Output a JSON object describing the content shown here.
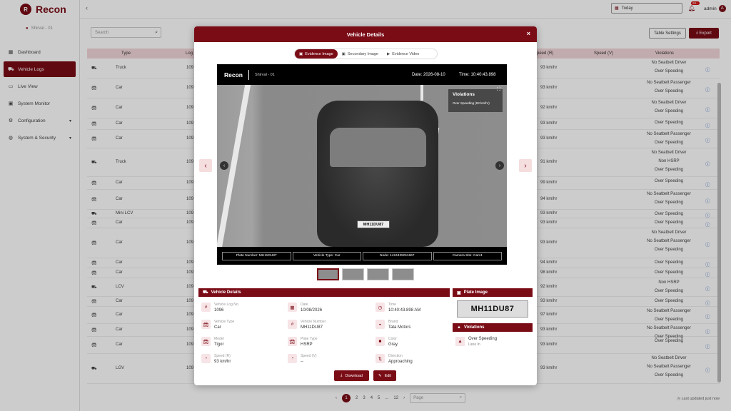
{
  "app": {
    "name": "Recon",
    "logo_letter": "R",
    "location": "Shirval - 01"
  },
  "sidebar": {
    "items": [
      {
        "label": "Dashboard",
        "icon": "grid-icon"
      },
      {
        "label": "Vehicle Logs",
        "icon": "car-icon",
        "active": true
      },
      {
        "label": "Live View",
        "icon": "camera-icon"
      },
      {
        "label": "System Monitor",
        "icon": "monitor-icon"
      },
      {
        "label": "Configuration",
        "icon": "gear-icon"
      },
      {
        "label": "System & Security",
        "icon": "globe-icon"
      }
    ]
  },
  "topbar": {
    "date_label": "Today",
    "notif_badge": "99+",
    "user": "admin",
    "user_initial": "A"
  },
  "toolbar": {
    "search_placeholder": "Search",
    "table_settings": "Table Settings",
    "export": "Export"
  },
  "table": {
    "headers": {
      "type": "Type",
      "log": "Log",
      "speed_r": "Speed (R)",
      "speed_v": "Speed (V)",
      "violations": "Violations"
    },
    "rows": [
      {
        "type": "Truck",
        "log": "109",
        "speed": "93 km/hr",
        "viol": [
          "No Seatbelt Driver",
          "Over Speeding"
        ]
      },
      {
        "type": "Car",
        "log": "109",
        "speed": "93 km/hr",
        "viol": [
          "No Seatbelt Passenger",
          "Over Speeding"
        ]
      },
      {
        "type": "Car",
        "log": "109",
        "speed": "92 km/hr",
        "viol": [
          "No Seatbelt Driver",
          "Over Speeding"
        ]
      },
      {
        "type": "Car",
        "log": "109",
        "speed": "93 km/hr",
        "viol": [
          "Over Speeding"
        ]
      },
      {
        "type": "Car",
        "log": "109",
        "speed": "93 km/hr",
        "viol": [
          "No Seatbelt Passenger",
          "Over Speeding"
        ]
      },
      {
        "type": "Truck",
        "log": "109",
        "speed": "91 km/hr",
        "viol": [
          "No Seatbelt Driver",
          "Non HSRP",
          "Over Speeding"
        ]
      },
      {
        "type": "Car",
        "log": "109",
        "speed": "99 km/hr",
        "viol": [
          "Over Speeding"
        ]
      },
      {
        "type": "Car",
        "log": "109",
        "speed": "94 km/hr",
        "viol": [
          "No Seatbelt Passenger",
          "Over Speeding"
        ]
      },
      {
        "type": "Mini LCV",
        "log": "109",
        "speed": "93 km/hr",
        "viol": [
          "Over Speeding"
        ]
      },
      {
        "type": "Car",
        "log": "109",
        "speed": "93 km/hr",
        "viol": [
          "Over Speeding"
        ]
      },
      {
        "type": "Car",
        "log": "109",
        "speed": "93 km/hr",
        "viol": [
          "No Seatbelt Driver",
          "No Seatbelt Passenger",
          "Over Speeding"
        ]
      },
      {
        "type": "Car",
        "log": "109",
        "speed": "94 km/hr",
        "viol": [
          "Over Speeding"
        ]
      },
      {
        "type": "Car",
        "log": "109",
        "speed": "98 km/hr",
        "viol": [
          "Over Speeding"
        ]
      },
      {
        "type": "LCV",
        "log": "109",
        "speed": "92 km/hr",
        "viol": [
          "Non HSRP",
          "Over Speeding"
        ]
      },
      {
        "type": "Car",
        "log": "109",
        "speed": "93 km/hr",
        "viol": [
          "Over Speeding"
        ]
      },
      {
        "type": "Car",
        "log": "109",
        "speed": "97 km/hr",
        "viol": [
          "No Seatbelt Passenger",
          "Over Speeding"
        ]
      },
      {
        "type": "Car",
        "log": "109",
        "speed": "93 km/hr",
        "viol": [
          "No Seatbelt Passenger",
          "Over Speeding"
        ]
      },
      {
        "type": "Car",
        "log": "109",
        "speed": "93 km/hr",
        "viol": [
          "Over Speeding"
        ]
      },
      {
        "type": "LGV",
        "log": "109",
        "speed": "93 km/hr",
        "viol": [
          "No Seatbelt Driver",
          "No Seatbelt Passenger",
          "Over Speeding"
        ]
      }
    ]
  },
  "pagination": {
    "pages": [
      "1",
      "2",
      "3",
      "4",
      "5",
      "...",
      "12"
    ],
    "prev": "‹",
    "next": "›",
    "page_placeholder": "Page"
  },
  "last_updated": "Last updated just now",
  "modal": {
    "title": "Vehicle Details",
    "close": "×",
    "tabs": [
      "Evidence Image",
      "Secondary Image",
      "Evidence Video"
    ],
    "viewer": {
      "brand": "Recon",
      "location": "Shirval - 01",
      "date": "Date: 2026-08-10",
      "time": "Time: 10:40:43.898",
      "plate_text": "MH11DU87",
      "violations_title": "Violations",
      "violation_line": "Over Speeding (93 km/hr)",
      "footer": [
        "Plate Number: MH11DU87",
        "Vehicle Type: Car",
        "Node: 1424425011667",
        "Camera Site: Cam1"
      ]
    },
    "details_title": "Vehicle Details",
    "fields": [
      {
        "label": "Vehicle Log No.",
        "value": "1096",
        "icon": "hash-icon"
      },
      {
        "label": "Date",
        "value": "10/08/2026",
        "icon": "calendar-icon"
      },
      {
        "label": "Time",
        "value": "10:40:43.898 AM",
        "icon": "clock-icon"
      },
      {
        "label": "Vehicle Type",
        "value": "Car",
        "icon": "car-icon"
      },
      {
        "label": "Vehicle Number",
        "value": "MH11DU87",
        "icon": "hash-icon"
      },
      {
        "label": "Brand",
        "value": "Tata Motors",
        "icon": "brand-icon"
      },
      {
        "label": "Model",
        "value": "Tigor",
        "icon": "car-icon"
      },
      {
        "label": "Plate Type",
        "value": "HSRP",
        "icon": "car-icon"
      },
      {
        "label": "Color",
        "value": "Gray",
        "icon": "color-swatch-icon"
      },
      {
        "label": "Speed (R)",
        "value": "93 km/hr",
        "icon": "speedometer-icon"
      },
      {
        "label": "Speed (V)",
        "value": "--",
        "icon": "speedometer-icon"
      },
      {
        "label": "Direction",
        "value": "Approaching",
        "icon": "direction-icon"
      }
    ],
    "plate_image_title": "Plate Image",
    "plate_image_text": "MH11DU87",
    "violations_title": "Violations",
    "violation_name": "Over Speeding",
    "violation_sub": "Lane In",
    "download": "Download",
    "edit": "Edit"
  }
}
